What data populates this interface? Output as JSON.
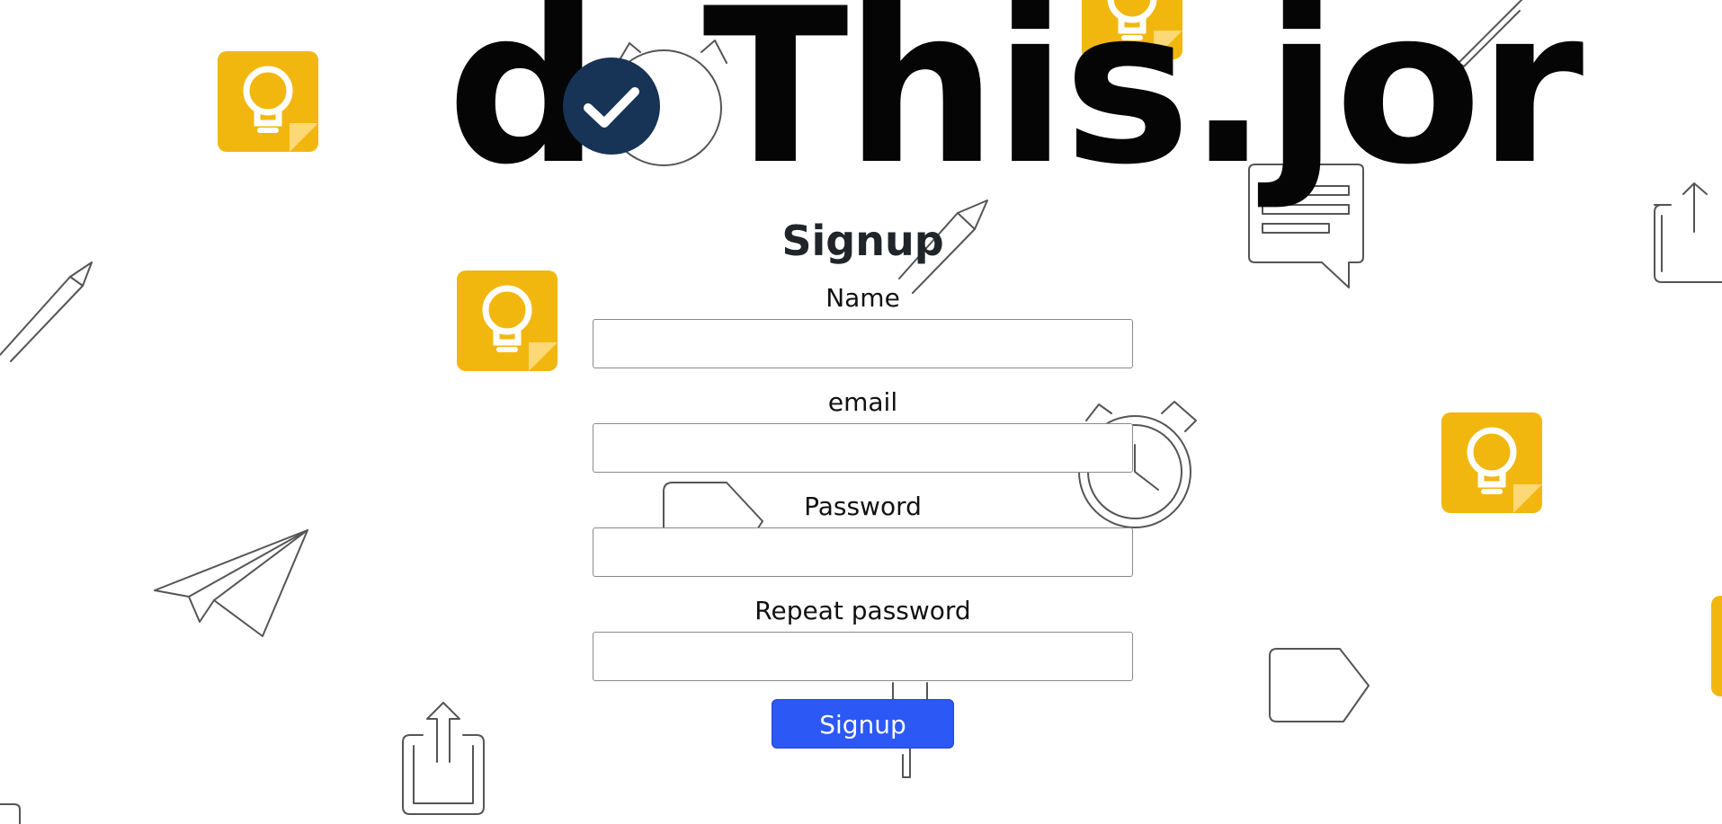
{
  "brand": {
    "logo_text_left": "d",
    "logo_text_right": "This.jor",
    "check_icon": "check-circle-icon",
    "check_color": "#173356"
  },
  "form": {
    "title": "Signup",
    "fields": [
      {
        "label": "Name",
        "placeholder": "",
        "value": ""
      },
      {
        "label": "email",
        "placeholder": "",
        "value": ""
      },
      {
        "label": "Password",
        "placeholder": "",
        "value": ""
      },
      {
        "label": "Repeat password",
        "placeholder": "",
        "value": ""
      }
    ],
    "submit_label": "Signup"
  },
  "colors": {
    "accent": "#2c58f5",
    "note_yellow": "#f2b70f",
    "note_fold": "#fdd876",
    "doodle_stroke": "#555555"
  },
  "decorations": {
    "icons": [
      "lightbulb-note-icon",
      "pencil-icon",
      "stopwatch-icon",
      "chat-bubble-icon",
      "share-icon",
      "paper-plane-icon",
      "label-tag-icon"
    ]
  }
}
